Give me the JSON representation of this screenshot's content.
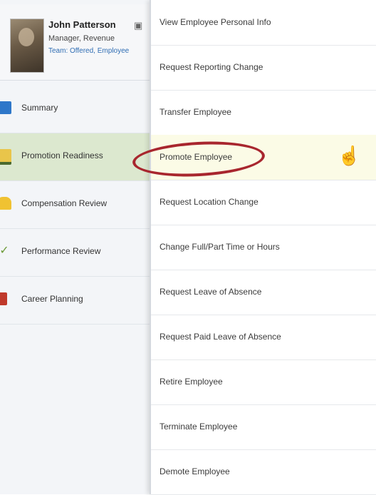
{
  "profile": {
    "name": "John Patterson",
    "title": "Manager, Revenue",
    "org": "Team: Offered, Employee"
  },
  "nav": {
    "items": [
      {
        "label": "Summary",
        "icon": "summary-icon"
      },
      {
        "label": "Promotion Readiness",
        "icon": "promotion-icon"
      },
      {
        "label": "Compensation Review",
        "icon": "compensation-icon"
      },
      {
        "label": "Performance Review",
        "icon": "performance-icon"
      },
      {
        "label": "Career Planning",
        "icon": "career-icon"
      }
    ],
    "active_index": 1
  },
  "menu": {
    "items": [
      "View Employee Personal Info",
      "Request Reporting Change",
      "Transfer Employee",
      "Promote Employee",
      "Request Location Change",
      "Change Full/Part Time or Hours",
      "Request Leave of Absence",
      "Request Paid Leave of Absence",
      "Retire Employee",
      "Terminate Employee",
      "Demote Employee"
    ],
    "highlighted_index": 3
  },
  "colors": {
    "highlight_circle": "#a8262e",
    "active_nav_bg": "#dce8cf",
    "hover_row_bg": "#fbfbe6"
  }
}
